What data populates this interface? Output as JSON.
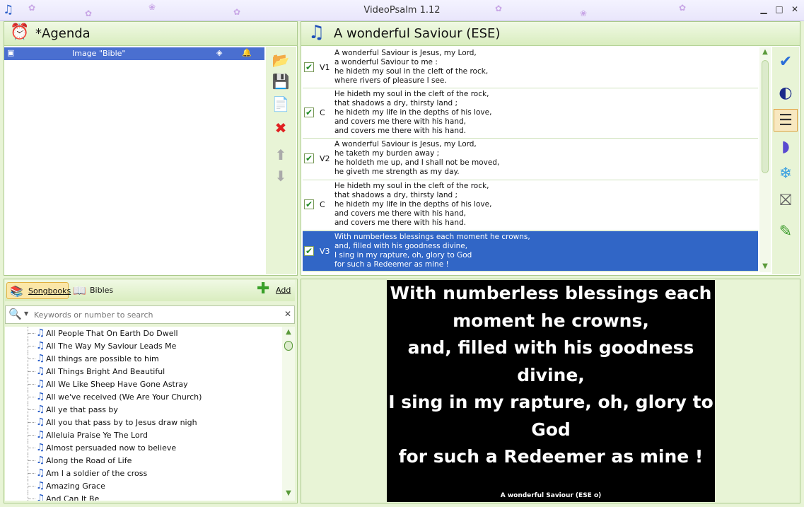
{
  "window": {
    "title": "VideoPsalm 1.12",
    "minimize": "▁",
    "maximize": "□",
    "close": "✕"
  },
  "agenda": {
    "title": "*Agenda",
    "items": [
      {
        "label": "Image \"Bible\""
      }
    ],
    "tools": [
      "open-folder-icon",
      "save-icon",
      "copy-icon",
      "delete-icon",
      "move-up-icon",
      "move-down-icon"
    ]
  },
  "song": {
    "title": "A wonderful Saviour (ESE)",
    "verses": [
      {
        "label": "V1",
        "checked": true,
        "text": "A wonderful Saviour is Jesus, my Lord,\na wonderful Saviour to me :\nhe hideth my soul in the cleft of the rock,\nwhere rivers of pleasure I see."
      },
      {
        "label": "C",
        "checked": true,
        "text": "He hideth my soul in the cleft of the rock,\nthat shadows a dry, thirsty land ;\nhe hideth my life in the depths of his love,\nand covers me there with his hand,\nand covers me there with his hand."
      },
      {
        "label": "V2",
        "checked": true,
        "text": "A wonderful Saviour is Jesus, my Lord,\nhe taketh my burden away ;\nhe holdeth me up, and I shall not be moved,\nhe giveth me strength as my day."
      },
      {
        "label": "C",
        "checked": true,
        "text": "He hideth my soul in the cleft of the rock,\nthat shadows a dry, thirsty land ;\nhe hideth my life in the depths of his love,\nand covers me there with his hand,\nand covers me there with his hand."
      },
      {
        "label": "V3",
        "checked": true,
        "selected": true,
        "text": "With numberless blessings each moment he crowns,\nand, filled with his goodness divine,\nI sing in my rapture, oh, glory to God\nfor such a Redeemer as mine !"
      }
    ]
  },
  "library": {
    "tabs": {
      "songbooks": "Songbooks",
      "bibles": "Bibles",
      "add": "Add"
    },
    "search_placeholder": "Keywords or number to search",
    "songs": [
      "All People That On Earth Do Dwell",
      "All The Way My Saviour Leads Me",
      "All things are possible to him",
      "All Things Bright And Beautiful",
      "All We Like Sheep Have Gone Astray",
      "All we've received (We Are Your Church)",
      "All ye that pass by",
      "All you that pass by to Jesus draw nigh",
      "Alleluia Praise Ye The Lord",
      "Almost persuaded now to believe",
      "Along the Road of Life",
      "Am I a soldier of the cross",
      "Amazing Grace",
      "And Can It Be"
    ]
  },
  "preview": {
    "text": "With numberless blessings each\nmoment he crowns,\nand, filled with his goodness\ndivine,\nI sing in my rapture, oh, glory to\nGod\nfor such a Redeemer as mine !",
    "footer": "A wonderful Saviour (ESE o)"
  }
}
